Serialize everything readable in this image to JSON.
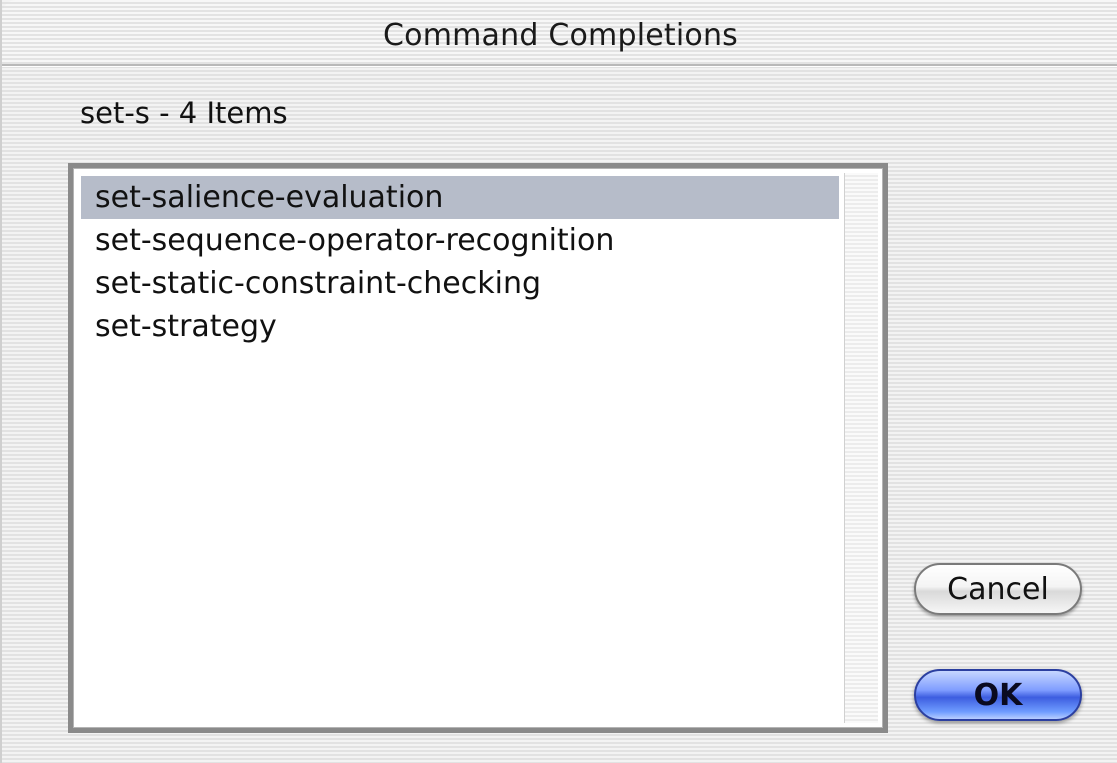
{
  "window": {
    "title": "Command Completions"
  },
  "summary": "set-s - 4 Items",
  "completions": [
    "set-salience-evaluation",
    "set-sequence-operator-recognition",
    "set-static-constraint-checking",
    "set-strategy"
  ],
  "selected_index": 0,
  "buttons": {
    "cancel_label": "Cancel",
    "ok_label": "OK"
  },
  "colors": {
    "selection": "#b6bcc9",
    "default_button": "#3d5de0"
  }
}
